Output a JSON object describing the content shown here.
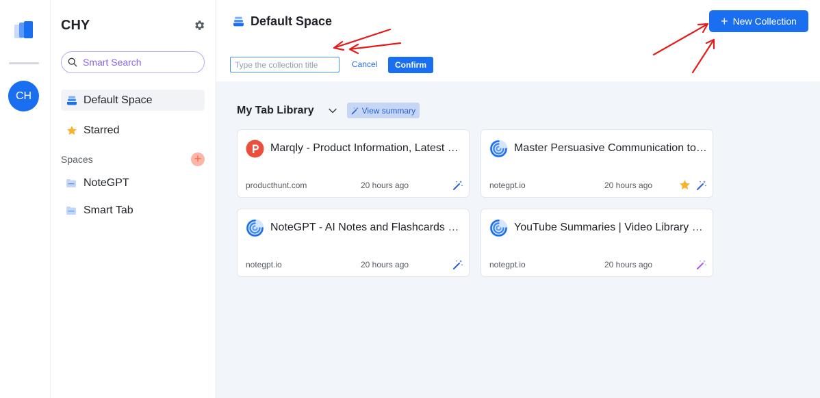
{
  "rail": {
    "avatar_initials": "CH"
  },
  "sidebar": {
    "workspace_name": "CHY",
    "search_placeholder": "Smart Search",
    "nav": [
      {
        "label": "Default Space",
        "icon": "stack-icon"
      },
      {
        "label": "Starred",
        "icon": "star-icon"
      }
    ],
    "spaces_label": "Spaces",
    "spaces_add": "+",
    "spaces": [
      {
        "label": "NoteGPT",
        "icon": "folder-icon"
      },
      {
        "label": "Smart Tab",
        "icon": "folder-icon"
      }
    ]
  },
  "main": {
    "space_title": "Default Space",
    "collection_input": {
      "value": "",
      "placeholder": "Type the collection title"
    },
    "cancel_label": "Cancel",
    "confirm_label": "Confirm",
    "new_collection_label": "New Collection",
    "new_collection_plus": "+",
    "library": {
      "title": "My Tab Library",
      "view_summary_label": "View summary"
    },
    "cards": [
      {
        "title": "Marqly - Product Information, Latest Products",
        "domain": "producthunt.com",
        "time": "20 hours ago",
        "icon": "producthunt-icon",
        "starred": false
      },
      {
        "title": "Master Persuasive Communication to Influence",
        "domain": "notegpt.io",
        "time": "20 hours ago",
        "icon": "notegpt-icon",
        "starred": true
      },
      {
        "title": "NoteGPT - AI Notes and Flashcards Learning",
        "domain": "notegpt.io",
        "time": "20 hours ago",
        "icon": "notegpt-icon",
        "starred": false
      },
      {
        "title": "YouTube Summaries | Video Library Page",
        "domain": "notegpt.io",
        "time": "20 hours ago",
        "icon": "notegpt-icon",
        "starred": false
      }
    ]
  },
  "colors": {
    "accent": "#1a6ef0",
    "annotation_arrows": "#e11d1d",
    "star": "#f5b42a",
    "wand": "#2a5fd4",
    "wand_alt": "#a855f7"
  }
}
